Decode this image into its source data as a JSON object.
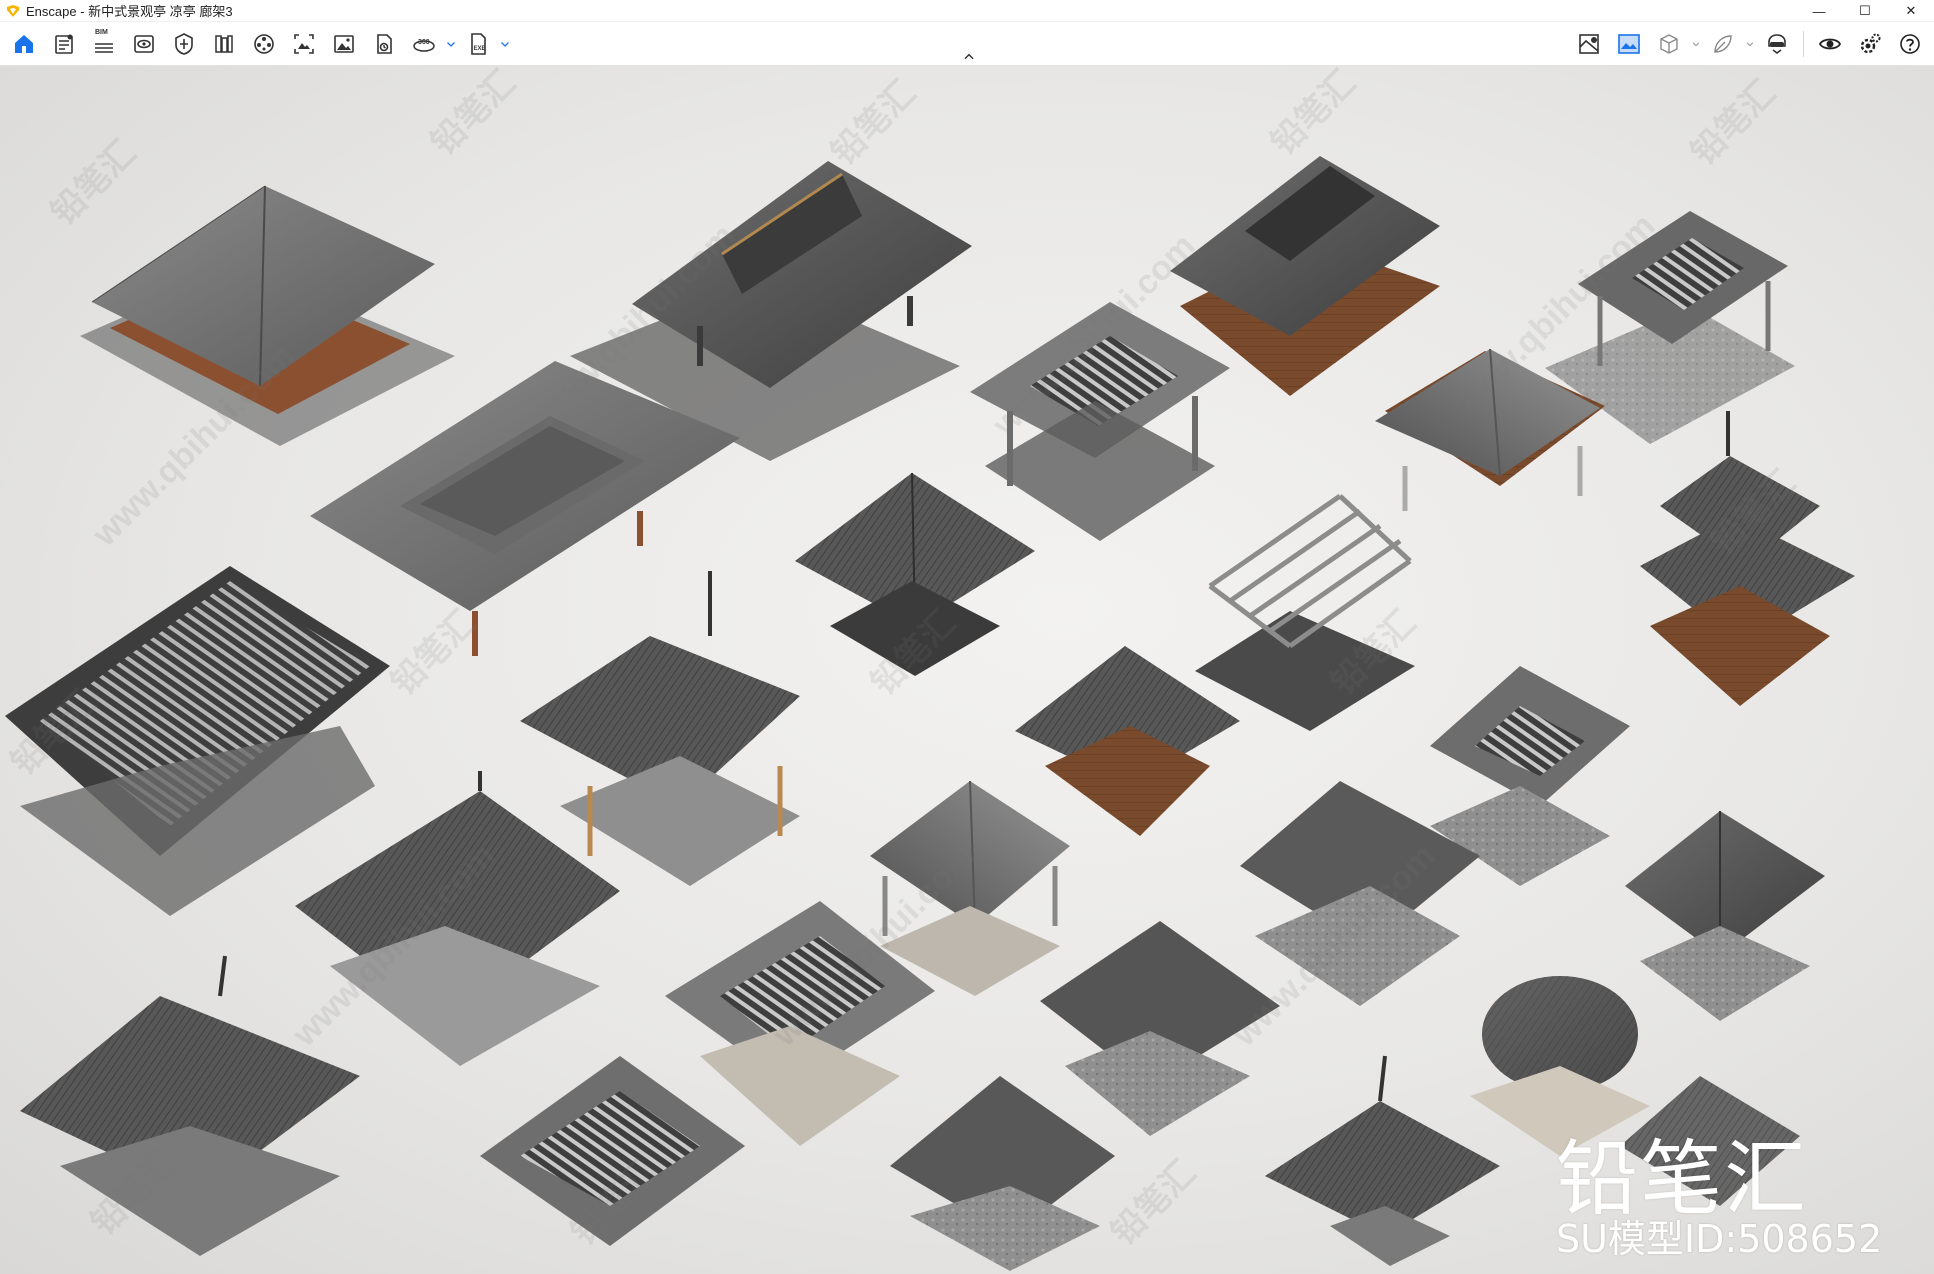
{
  "window": {
    "title": "Enscape - 新中式景观亭 凉亭 廊架3",
    "minimize_glyph": "—",
    "maximize_glyph": "☐",
    "close_glyph": "✕"
  },
  "toolbar": {
    "left_icons": [
      "home-icon",
      "document-list-icon",
      "bim-icon",
      "view-icon",
      "visual-settings-icon",
      "library-icon",
      "material-editor-icon",
      "screenshot-icon",
      "image-export-icon",
      "batch-render-icon",
      "panorama-360-icon",
      "exe-export-icon"
    ],
    "bim_label": "BIM",
    "pano_label": "360",
    "exe_label": "EXE",
    "right_icons": [
      "site-context-icon",
      "capture-icon",
      "asset-cube-icon",
      "asset-leaf-icon",
      "vr-headset-icon",
      "eye-icon",
      "settings-icon",
      "help-icon"
    ],
    "accent_color": "#1a73e8"
  },
  "viewport": {
    "watermark_text": "www.qbihui.com",
    "watermark_brand": "铅笔汇",
    "brand_text": "铅笔汇",
    "model_id_text": "SU模型ID:508652"
  }
}
